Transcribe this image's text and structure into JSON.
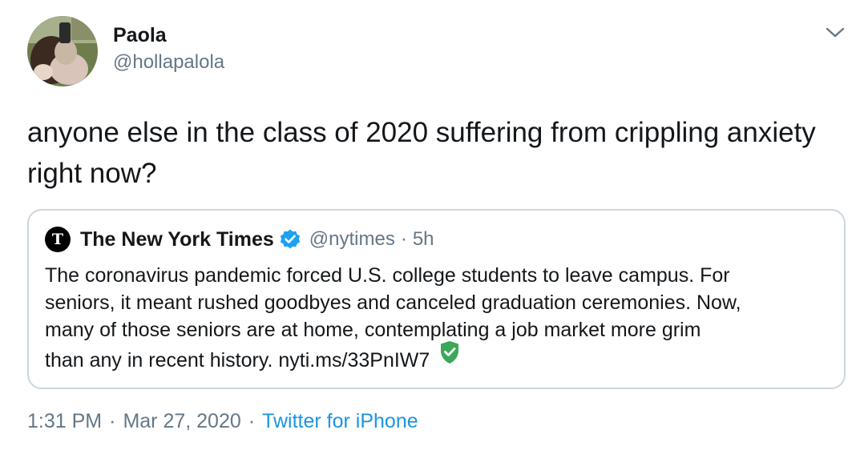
{
  "author": {
    "display_name": "Paola",
    "handle": "@hollapalola",
    "avatar_icon": "avatar-photo"
  },
  "menu_icon": "chevron-down-icon",
  "tweet": {
    "text": "anyone else in the class of 2020 suffering from crippling anxiety right now?"
  },
  "quoted": {
    "logo_letter": "T",
    "name": "The New York Times",
    "verified_icon": "verified-badge-icon",
    "handle": "@nytimes",
    "dot": "·",
    "time": "5h",
    "lines": [
      "The coronavirus pandemic forced U.S. college students to leave campus.  For",
      "seniors, it meant rushed goodbyes and canceled graduation ceremonies. Now,",
      "many of those seniors are at home, contemplating a job market more grim"
    ],
    "last_line": "than any in recent history. nyti.ms/33PnIW7",
    "link_icon": "shield-check-icon"
  },
  "meta": {
    "time": "1:31 PM",
    "sep1": "·",
    "date": "Mar 27, 2020",
    "sep2": "·",
    "source": "Twitter for iPhone"
  },
  "colors": {
    "text": "#14171a",
    "secondary": "#657786",
    "link": "#1b95e0",
    "border": "#ccd6dd",
    "verified": "#1da1f2",
    "shield": "#3aa858"
  }
}
